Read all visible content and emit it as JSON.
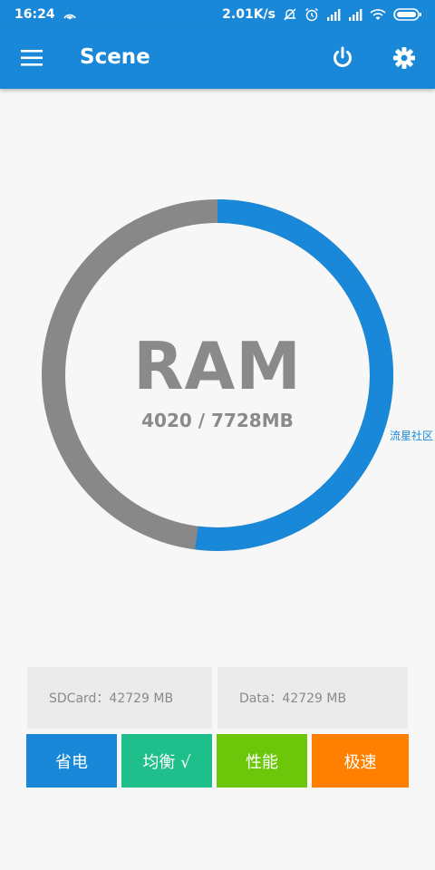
{
  "status_bar": {
    "time": "16:24",
    "net_speed": "2.01K/s",
    "icons": [
      "hotspot-icon",
      "mute-icon",
      "alarm-icon",
      "signal-icon",
      "signal-icon",
      "wifi-icon",
      "battery-icon"
    ]
  },
  "app_bar": {
    "title": "Scene",
    "icons": [
      "menu-icon",
      "power-icon",
      "settings-icon"
    ]
  },
  "ram": {
    "label": "RAM",
    "usage_text": "4020 / 7728MB",
    "used_mb": 4020,
    "total_mb": 7728
  },
  "watermark": "流星社区",
  "storage": {
    "sdcard": "SDCard：42729 MB",
    "data": "Data：42729 MB"
  },
  "modes": {
    "powersave": "省电",
    "balance": "均衡 √",
    "performance": "性能",
    "fast": "极速"
  },
  "bottom_hint": "滑动上滑以显示底部菜单",
  "colors": {
    "primary": "#1a88d8",
    "gauge_track": "#888888",
    "balance": "#1fbf8c",
    "performance": "#6cc70b",
    "fast": "#ff7f00"
  }
}
